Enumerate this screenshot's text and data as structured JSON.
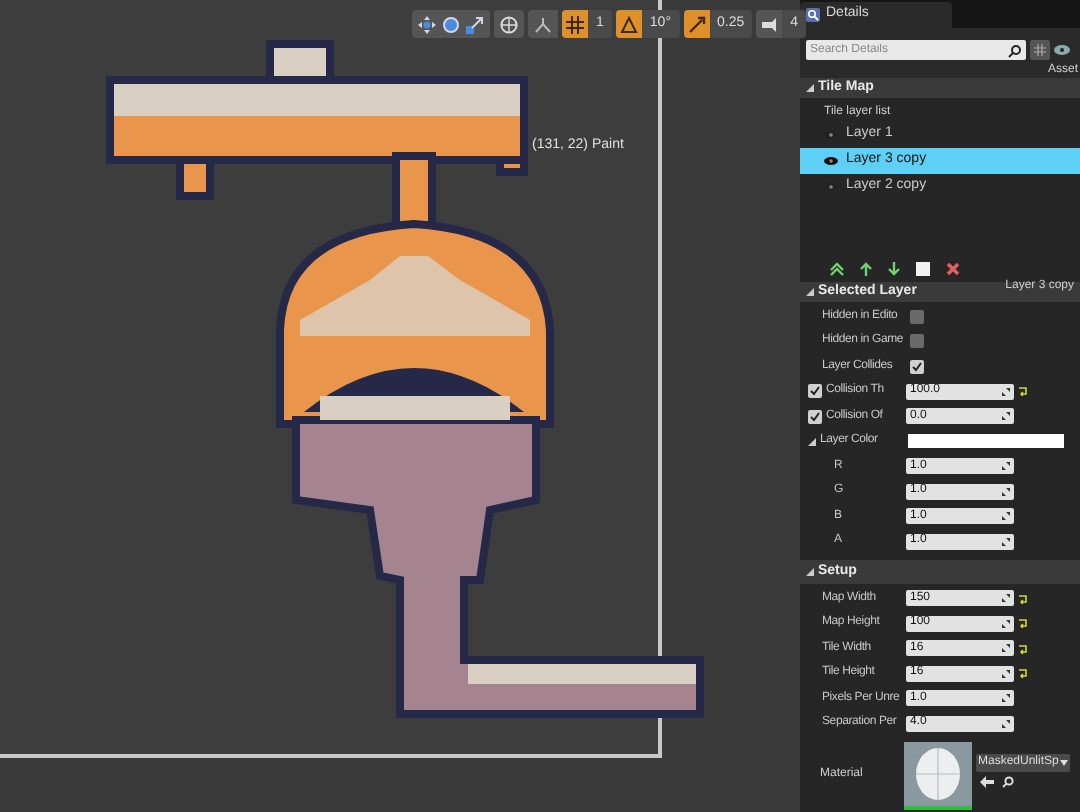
{
  "viewport": {
    "status": "(131, 22) Paint",
    "snap_toolbar": [
      {
        "value": "1",
        "active": true
      },
      {
        "value": "10°",
        "active": true
      },
      {
        "value": "0.25",
        "active": true
      },
      {
        "value": "4",
        "active": false
      }
    ]
  },
  "details": {
    "tab": "Details",
    "search": {
      "placeholder": "Search Details"
    },
    "asset_label": "Asset",
    "tile_map": {
      "header": "Tile Map",
      "list_label": "Tile layer list",
      "layers": [
        {
          "name": "Layer 1",
          "selected": false
        },
        {
          "name": "Layer 3 copy",
          "selected": true
        },
        {
          "name": "Layer 2 copy",
          "selected": false
        }
      ]
    },
    "selected_layer": {
      "header": "Selected Layer",
      "layer_name": "Layer 3 copy",
      "rows": [
        {
          "kind": "checkbox",
          "label": "Hidden in Edito",
          "checked": false
        },
        {
          "kind": "checkbox",
          "label": "Hidden in Game",
          "checked": false
        },
        {
          "kind": "checkbox",
          "label": "Layer Collides",
          "checked": true
        },
        {
          "kind": "toggled_number",
          "label": "Collision Th",
          "checked": true,
          "value": "100.0",
          "modified": true
        },
        {
          "kind": "toggled_number",
          "label": "Collision Of",
          "checked": true,
          "value": "0.0",
          "modified": false
        },
        {
          "kind": "color",
          "label": "Layer Color",
          "color": "#ffffff"
        },
        {
          "kind": "sub_number",
          "label": "R",
          "value": "1.0",
          "modified": false
        },
        {
          "kind": "sub_number",
          "label": "G",
          "value": "1.0",
          "modified": false
        },
        {
          "kind": "sub_number",
          "label": "B",
          "value": "1.0",
          "modified": false
        },
        {
          "kind": "sub_number",
          "label": "A",
          "value": "1.0",
          "modified": false
        }
      ]
    },
    "setup": {
      "header": "Setup",
      "rows": [
        {
          "kind": "number",
          "label": "Map Width",
          "value": "150",
          "modified": true
        },
        {
          "kind": "number",
          "label": "Map Height",
          "value": "100",
          "modified": true
        },
        {
          "kind": "number",
          "label": "Tile Width",
          "value": "16",
          "modified": true
        },
        {
          "kind": "number",
          "label": "Tile Height",
          "value": "16",
          "modified": true
        },
        {
          "kind": "number",
          "label": "Pixels Per Unre",
          "value": "1.0",
          "modified": false
        },
        {
          "kind": "number",
          "label": "Separation Per",
          "value": "4.0",
          "modified": false
        }
      ],
      "material": {
        "label": "Material",
        "value": "MaskedUnlitSp"
      }
    }
  }
}
